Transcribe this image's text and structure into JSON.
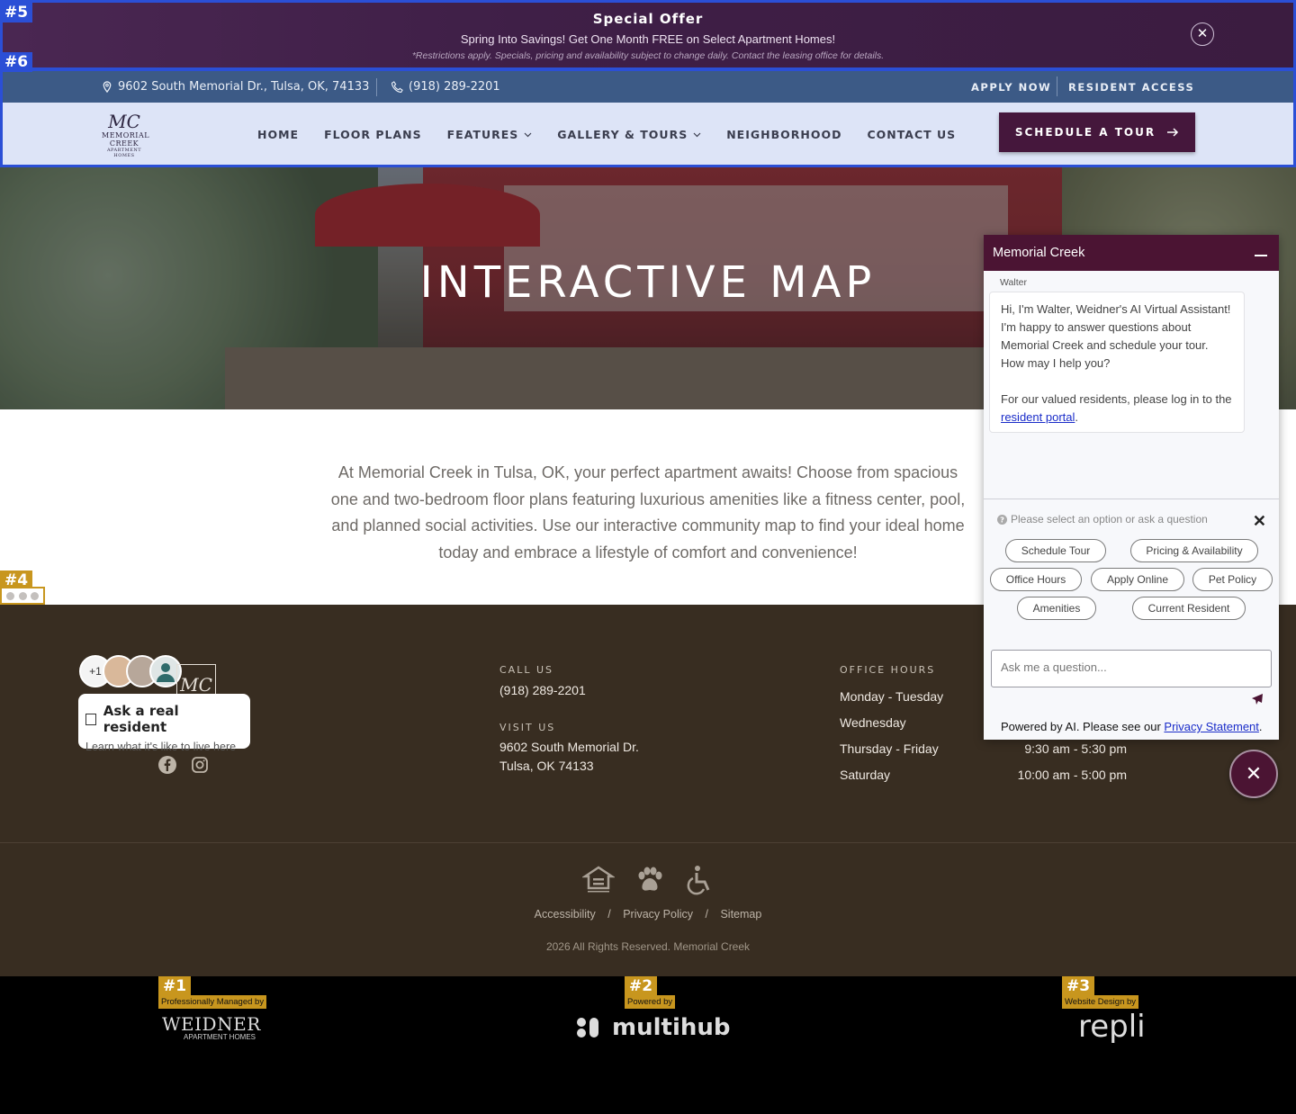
{
  "offer": {
    "tag": "#5",
    "title": "Special Offer",
    "text": "Spring Into Savings! Get One Month FREE on Select Apartment Homes!",
    "fine_print": "*Restrictions apply. Specials, pricing and availability subject to change daily. Contact the leasing office for details.",
    "close_symbol": "✕"
  },
  "header": {
    "tag": "#6",
    "address": "9602 South Memorial Dr., Tulsa, OK, 74133",
    "phone": "(918) 289-2201",
    "apply": "APPLY NOW",
    "resident": "RESIDENT ACCESS",
    "logo": {
      "mono": "MC",
      "line1": "MEMORIAL",
      "line2": "CREEK",
      "line3": "APARTMENT HOMES"
    },
    "nav": [
      {
        "label": "HOME",
        "dropdown": false
      },
      {
        "label": "FLOOR PLANS",
        "dropdown": false
      },
      {
        "label": "FEATURES",
        "dropdown": true
      },
      {
        "label": "GALLERY & TOURS",
        "dropdown": true
      },
      {
        "label": "NEIGHBORHOOD",
        "dropdown": false
      },
      {
        "label": "CONTACT US",
        "dropdown": false
      }
    ],
    "cta": "SCHEDULE A TOUR"
  },
  "hero": {
    "title": "INTERACTIVE MAP"
  },
  "intro": {
    "text": "At Memorial Creek in Tulsa, OK, your perfect apartment awaits! Choose from spacious one and two-bedroom floor plans featuring luxurious amenities like a fitness center, pool, and planned social activities. Use our interactive community map to find your ideal home today and embrace a lifestyle of comfort and convenience!"
  },
  "carousel_tag": "#4",
  "footer": {
    "avatars_more": "+1",
    "ask_title": "Ask a real resident",
    "ask_sub": "Learn what it's like to live here",
    "call_label": "CALL US",
    "call_value": "(918) 289-2201",
    "visit_label": "VISIT US",
    "visit_line1": "9602 South Memorial Dr.",
    "visit_line2": "Tulsa, OK 74133",
    "hours_label": "OFFICE HOURS",
    "hours": [
      {
        "day": "Monday - Tuesday",
        "time": ""
      },
      {
        "day": "Wednesday",
        "time": ""
      },
      {
        "day": "Thursday - Friday",
        "time": "9:30 am - 5:30 pm"
      },
      {
        "day": "Saturday",
        "time": "10:00 am - 5:00 pm"
      }
    ],
    "links": [
      "Accessibility",
      "Privacy Policy",
      "Sitemap"
    ],
    "link_sep": "/",
    "copyright": "2026 All Rights Reserved. Memorial Creek"
  },
  "credits": [
    {
      "tag": "#1",
      "label": "Professionally Managed by",
      "brand": "WEIDNER",
      "brand_sub": "APARTMENT HOMES"
    },
    {
      "tag": "#2",
      "label": "Powered by",
      "brand": "multihub"
    },
    {
      "tag": "#3",
      "label": "Website Design by",
      "brand": "repli"
    }
  ],
  "chat": {
    "title": "Memorial Creek",
    "agent": "Walter",
    "message_1": "Hi, I'm Walter, Weidner's AI Virtual Assistant! I'm happy to answer questions about Memorial Creek and schedule your tour. How may I help you?",
    "message_2": "For our valued residents, please log in to the",
    "message_link": "resident portal",
    "message_end": ".",
    "hint": "Please select an option or ask a question",
    "chips": [
      "Schedule Tour",
      "Pricing & Availability",
      "Office Hours",
      "Apply Online",
      "Pet Policy",
      "Amenities",
      "Current Resident"
    ],
    "input_placeholder": "Ask me a question...",
    "powered_text": "Powered by AI. Please see our",
    "powered_link": "Privacy Statement",
    "powered_end": "."
  }
}
